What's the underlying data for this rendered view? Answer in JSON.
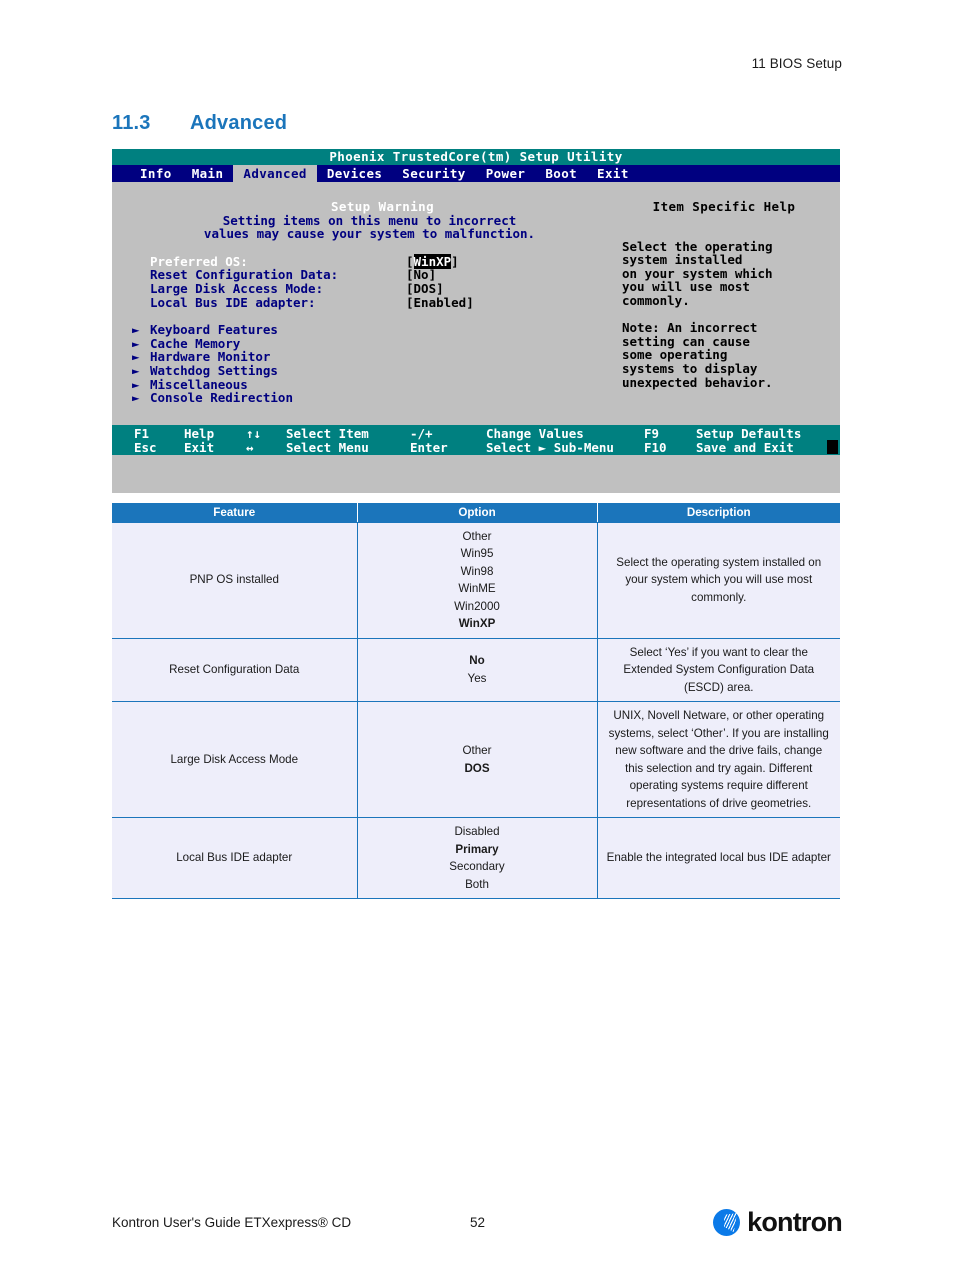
{
  "document": {
    "running_header": "11 BIOS Setup",
    "section_number": "11.3",
    "section_title": "Advanced",
    "accent_color": "#1b75bb"
  },
  "bios": {
    "title": "Phoenix TrustedCore(tm) Setup Utility",
    "title_bg": "#008080",
    "menubar_bg": "#000080",
    "screen_bg": "#c0c0c0",
    "menu": [
      {
        "label": "Info",
        "active": false
      },
      {
        "label": "Main",
        "active": false
      },
      {
        "label": "Advanced",
        "active": true
      },
      {
        "label": "Devices",
        "active": false
      },
      {
        "label": "Security",
        "active": false
      },
      {
        "label": "Power",
        "active": false
      },
      {
        "label": "Boot",
        "active": false
      },
      {
        "label": "Exit",
        "active": false
      }
    ],
    "warning": {
      "title": "Setup Warning",
      "line1": "Setting items on this menu to incorrect",
      "line2": "values may cause your system to malfunction."
    },
    "settings": [
      {
        "label": "Preferred OS:",
        "value": "WinXP",
        "selected": true
      },
      {
        "label": "Reset Configuration Data:",
        "value": "No",
        "selected": false
      },
      {
        "label": "Large Disk Access Mode:",
        "value": "DOS",
        "selected": false
      },
      {
        "label": "Local Bus IDE adapter:",
        "value": "Enabled",
        "selected": false
      }
    ],
    "submenus": [
      "Keyboard Features",
      "Cache Memory",
      "Hardware Monitor",
      "Watchdog Settings",
      "Miscellaneous",
      "Console Redirection"
    ],
    "help": {
      "title": "Item Specific Help",
      "lines": [
        "Select the operating",
        "system installed",
        "on your system which",
        "you will use most",
        "commonly.",
        "",
        "Note: An incorrect",
        "setting can cause",
        "some operating",
        "systems to display",
        "unexpected behavior."
      ]
    },
    "function_keys": {
      "row1": {
        "k1": "F1",
        "a1": "Help",
        "k2": "↑↓",
        "a2": "Select Item",
        "k3": "-/+",
        "a3": "Change Values",
        "k4": "F9",
        "a4": "Setup Defaults"
      },
      "row2": {
        "k1": "Esc",
        "a1": "Exit",
        "k2": "↔",
        "a2": "Select Menu",
        "k3": "Enter",
        "a3": "Select ► Sub-Menu",
        "k4": "F10",
        "a4": "Save and Exit"
      }
    }
  },
  "table": {
    "headers": [
      "Feature",
      "Option",
      "Description"
    ],
    "rows": [
      {
        "feature": "PNP OS installed",
        "options": [
          {
            "text": "Other",
            "bold": false
          },
          {
            "text": "Win95",
            "bold": false
          },
          {
            "text": "Win98",
            "bold": false
          },
          {
            "text": "WinME",
            "bold": false
          },
          {
            "text": "Win2000",
            "bold": false
          },
          {
            "text": "WinXP",
            "bold": true
          }
        ],
        "description": "Select the operating system installed on your system which you will use most commonly."
      },
      {
        "feature": "Reset Configuration Data",
        "options": [
          {
            "text": "No",
            "bold": true
          },
          {
            "text": "Yes",
            "bold": false
          }
        ],
        "description": "Select ‘Yes’ if you want to clear the Extended System Configuration Data (ESCD) area."
      },
      {
        "feature": "Large Disk Access Mode",
        "options": [
          {
            "text": "Other",
            "bold": false
          },
          {
            "text": "DOS",
            "bold": true
          }
        ],
        "description": "UNIX, Novell Netware, or other operating systems, select ‘Other’. If you are installing new software and the drive fails, change this selection and try again. Different operating systems require different representations of drive geometries."
      },
      {
        "feature": "Local Bus IDE adapter",
        "options": [
          {
            "text": "Disabled",
            "bold": false
          },
          {
            "text": "Primary",
            "bold": true
          },
          {
            "text": "Secondary",
            "bold": false
          },
          {
            "text": "Both",
            "bold": false
          }
        ],
        "description": "Enable the integrated local bus IDE adapter"
      }
    ]
  },
  "footer": {
    "guide": "Kontron User's Guide ETXexpress® CD",
    "page_number": "52",
    "brand": "kontron"
  }
}
